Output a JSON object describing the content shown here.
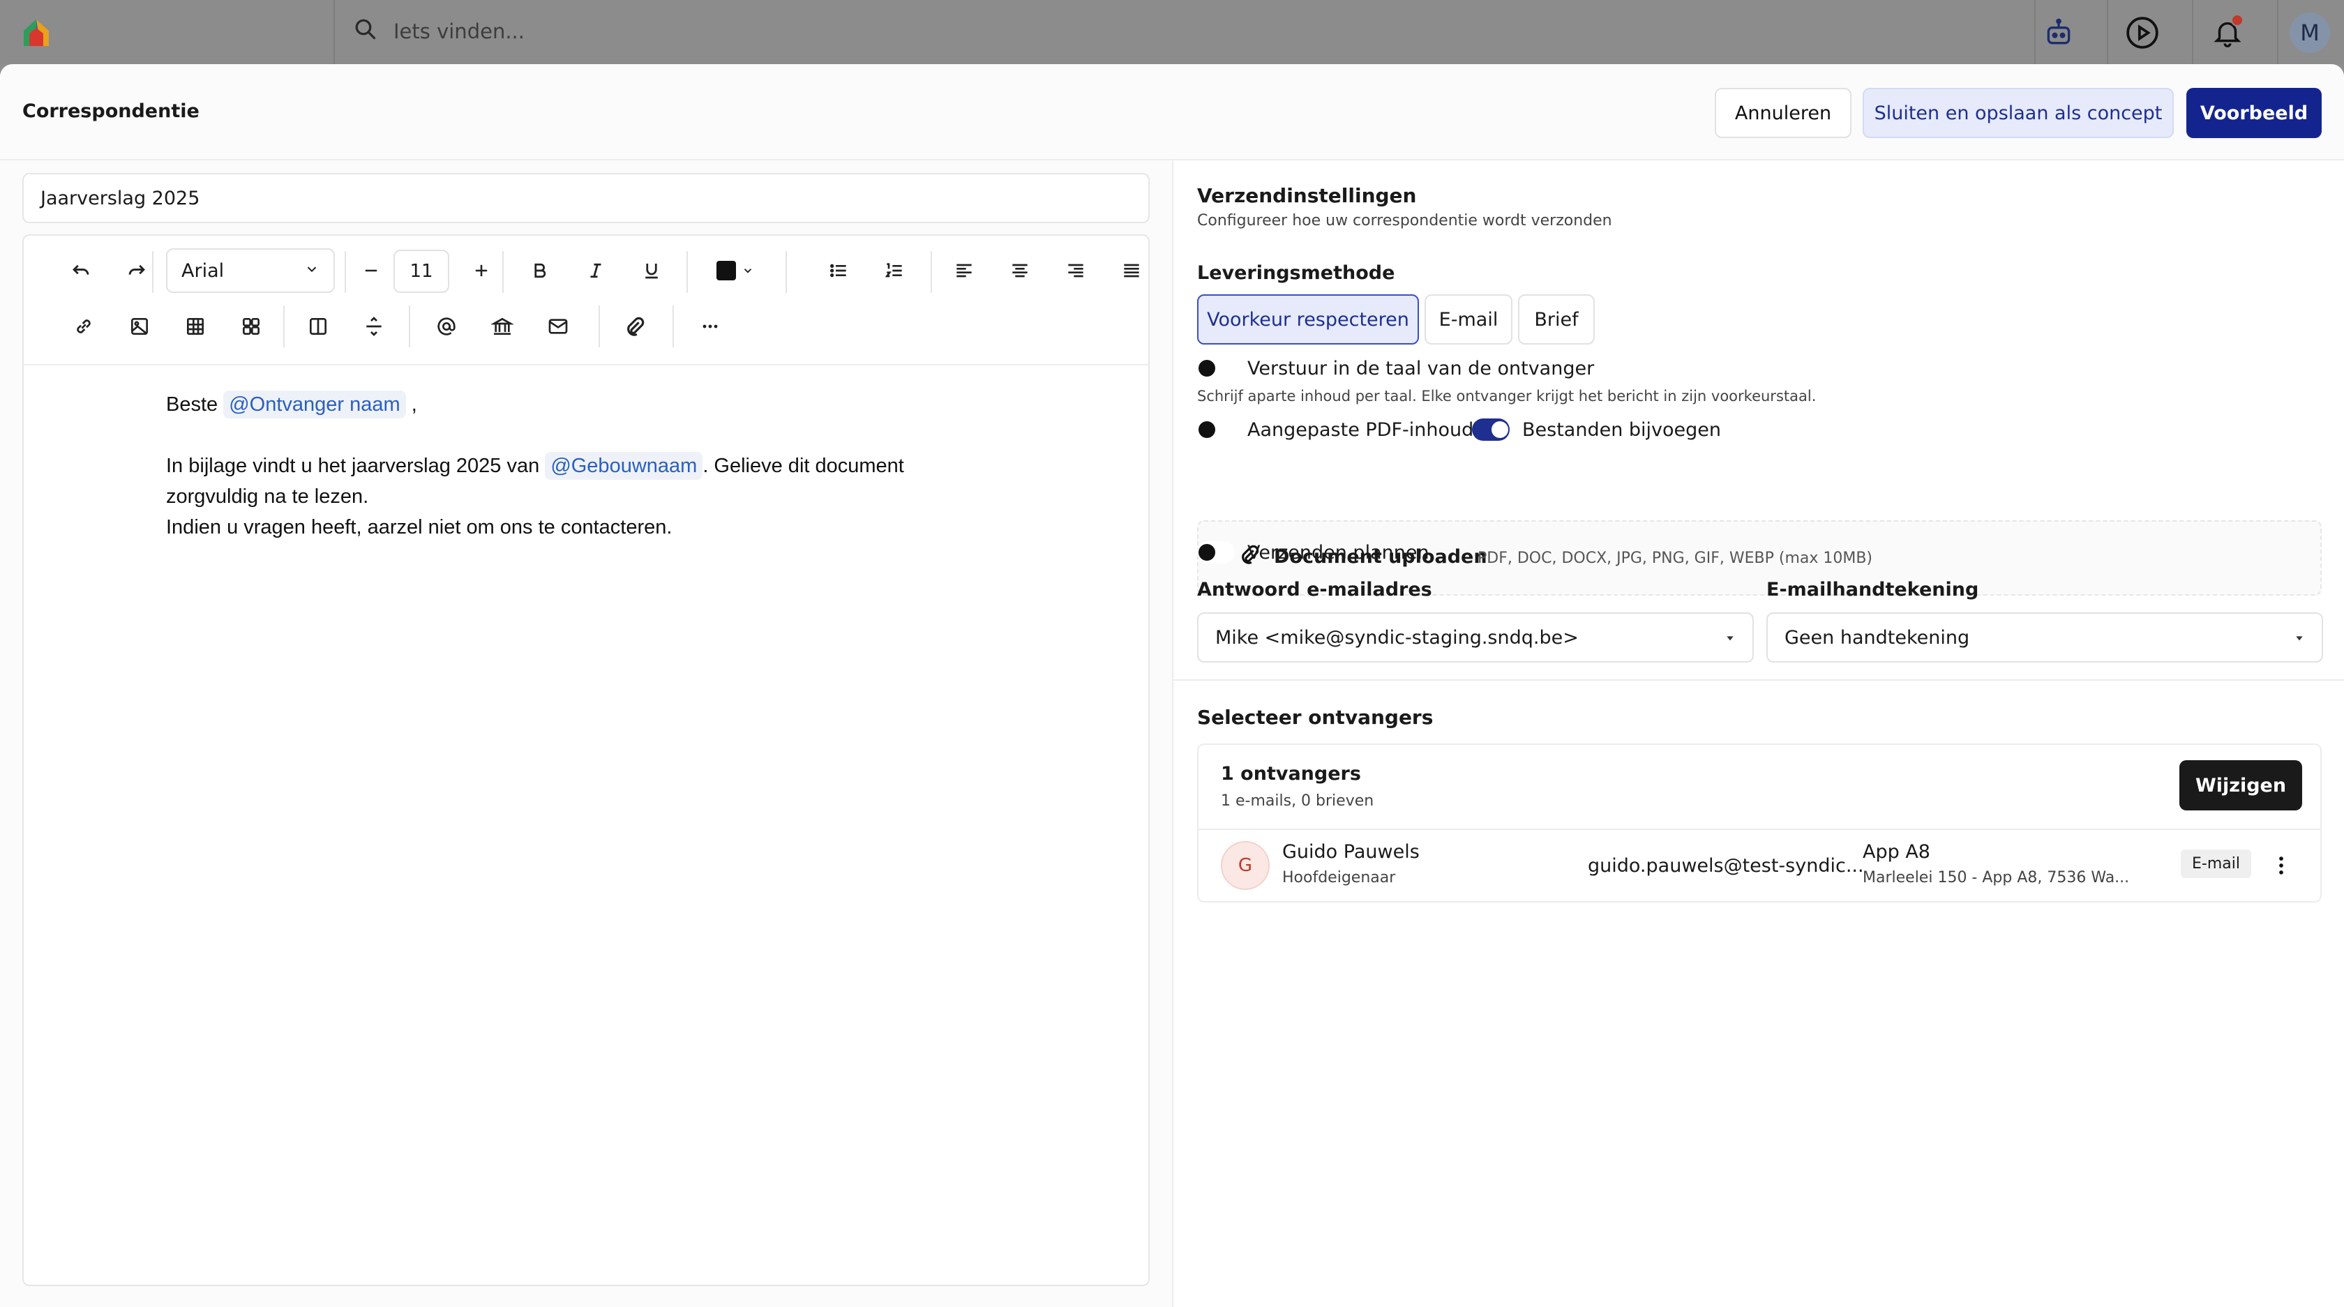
{
  "topbar": {
    "search_placeholder": "Iets vinden...",
    "avatar_initial": "M"
  },
  "modal": {
    "title": "Correspondentie",
    "cancel_label": "Annuleren",
    "draft_label": "Sluiten en opslaan als concept",
    "preview_label": "Voorbeeld"
  },
  "editor": {
    "subject": "Jaarverslag 2025",
    "font": "Arial",
    "font_size": "11",
    "body": {
      "greeting_prefix": "Beste",
      "greeting_mention": "@Ontvanger naam",
      "greeting_suffix": ",",
      "line1_prefix": "In bijlage vindt u het jaarverslag 2025 van",
      "line1_mention": "@Gebouwnaam",
      "line1_suffix": ". Gelieve dit document",
      "line2": "zorgvuldig na te lezen.",
      "line3": "Indien u vragen heeft, aarzel niet om ons te contacteren."
    }
  },
  "settings": {
    "title": "Verzendinstellingen",
    "subtitle": "Configureer hoe uw correspondentie wordt verzonden",
    "delivery_label": "Leveringsmethode",
    "delivery_options": [
      "Voorkeur respecteren",
      "E-mail",
      "Brief"
    ],
    "delivery_selected": "Voorkeur respecteren",
    "toggle_language": "Verstuur in de taal van de ontvanger",
    "toggle_language_hint": "Schrijf aparte inhoud per taal. Elke ontvanger krijgt het bericht in zijn voorkeurstaal.",
    "toggle_pdf": "Aangepaste PDF-inhoud",
    "toggle_attach": "Bestanden bijvoegen",
    "upload_label": "Document uploaden",
    "upload_hint": "PDF, DOC, DOCX, JPG, PNG, GIF, WEBP (max 10MB)",
    "toggle_schedule": "Verzenden plannen",
    "reply_label": "Antwoord e-mailadres",
    "reply_value": "Mike <mike@syndic-staging.sndq.be>",
    "signature_label": "E-mailhandtekening",
    "signature_value": "Geen handtekening"
  },
  "recipients": {
    "title": "Selecteer ontvangers",
    "count": "1 ontvangers",
    "summary": "1 e-mails, 0 brieven",
    "change_label": "Wijzigen",
    "items": [
      {
        "initial": "G",
        "name": "Guido Pauwels",
        "role": "Hoofdeigenaar",
        "email": "guido.pauwels@test-syndic...",
        "unit": "App A8",
        "address": "Marleelei 150 - App A8, 7536 Wa...",
        "channel": "E-mail"
      }
    ]
  },
  "colors": {
    "primary": "#14248f",
    "primary_soft": "#e6eafb",
    "mention": "#2b5fc0",
    "dark_button": "#1a1a1a"
  }
}
